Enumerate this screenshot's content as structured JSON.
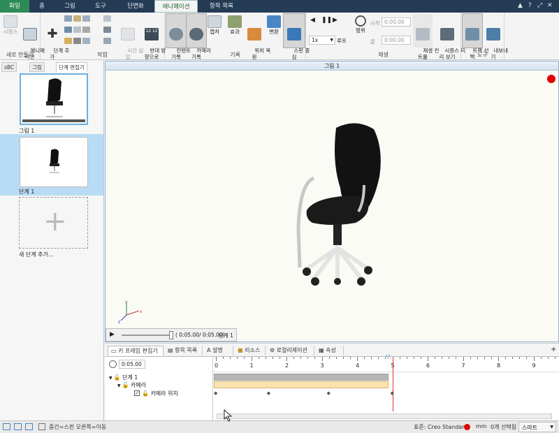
{
  "tabs": [
    "파일",
    "홈",
    "그림",
    "도구",
    "단면화",
    "애니메이션",
    "항목 목록"
  ],
  "window_icons": [
    "▲",
    "?",
    "⤢",
    "✕"
  ],
  "ribbon": {
    "new_group": {
      "label": "새로 만들기",
      "sequence": "시퀀스",
      "animation": "애니메\n이션"
    },
    "work_group": {
      "label": "작업",
      "add_step": "단계 추\n가",
      "time_insert": "시간 삽\n입",
      "reverse": "반대 방\n향으로"
    },
    "record_group": {
      "label": "기록",
      "content_record": "컨텐트\n기록",
      "camera_record": "카메라\n기록",
      "capture": "캡처",
      "effect": "효과",
      "position_restore": "위치 복\n원",
      "transform": "변환",
      "spin_center": "스핀 중\n심"
    },
    "playback_group": {
      "label": "재생",
      "speed": "1x",
      "loop": "루프",
      "range": "범위",
      "start_label": "시작",
      "start_value": "0:00.00",
      "end_label": "끝",
      "end_value": "0:00.00",
      "playback_controls": "재생 컨\n트롤",
      "sequence_preview": "시퀀스 미\n리 보기"
    },
    "tools_group": {
      "label": "도구",
      "track_select": "트랙 선\n택",
      "export": "내보내\n기"
    }
  },
  "left_panel": {
    "tabs": [
      "sBC",
      "그림",
      "단계 편집기"
    ],
    "thumbnails": [
      {
        "label": "그림 1"
      },
      {
        "label": "단계 1"
      },
      {
        "label": "새 단계 추가..."
      }
    ]
  },
  "viewport": {
    "title": "그림 1",
    "player_time": "( 0:05.00/ 0:05.00)",
    "player_step": "단계 1",
    "axes": {
      "x": "x",
      "y": "y",
      "z": "z"
    }
  },
  "keyframe_panel": {
    "tabs": [
      "키 프레임 편집기",
      "항목 목록",
      "설명",
      "리소스",
      "로컬리제이션",
      "속성"
    ],
    "time_field": "0:05.00",
    "tree": [
      "단계 1",
      "카메라",
      "카메라 위치"
    ],
    "ruler": [
      "0",
      "1",
      "2",
      "3",
      "4",
      "5",
      "6",
      "7",
      "8",
      "9"
    ],
    "playhead_at": 5,
    "range_end": 5
  },
  "status_bar": {
    "hint": "중간=스핀  오른쪽=이동",
    "standard": "표준: Creo Standard",
    "unit": "mm",
    "selected": "0개 선택됨",
    "filter": "스마트"
  },
  "colors": {
    "tabbar": "#243b55",
    "file_tab": "#2e8b57",
    "selection": "#b9dcf5",
    "record_dot": "#e00000",
    "keyframe_fill": "#fbe3b0"
  }
}
